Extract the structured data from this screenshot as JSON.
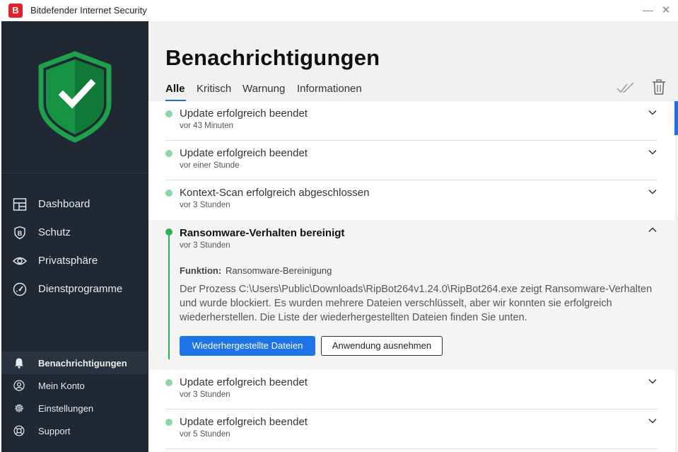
{
  "window": {
    "title": "Bitdefender Internet Security",
    "logo_letter": "B",
    "close_glyph": "✕"
  },
  "colors": {
    "sidebar_bg": "#1f2833",
    "accent_blue": "#1e73e6",
    "success_green": "#2db35d",
    "dot_light_green": "#8fd6a6",
    "brand_red": "#e5202a"
  },
  "sidebar": {
    "status_icon": "shield-check-icon",
    "nav": [
      {
        "label": "Dashboard",
        "icon": "dashboard-icon"
      },
      {
        "label": "Schutz",
        "icon": "protection-shield-icon"
      },
      {
        "label": "Privatsphäre",
        "icon": "eye-icon"
      },
      {
        "label": "Dienstprogramme",
        "icon": "gauge-icon"
      }
    ],
    "bottom": [
      {
        "label": "Benachrichtigungen",
        "icon": "bell-icon",
        "active": true
      },
      {
        "label": "Mein Konto",
        "icon": "user-icon"
      },
      {
        "label": "Einstellungen",
        "icon": "gear-icon"
      },
      {
        "label": "Support",
        "icon": "lifebuoy-icon"
      }
    ]
  },
  "main": {
    "title": "Benachrichtigungen",
    "tabs": [
      {
        "label": "Alle",
        "active": true
      },
      {
        "label": "Kritisch"
      },
      {
        "label": "Warnung"
      },
      {
        "label": "Informationen"
      }
    ],
    "toolbar_icons": [
      "mark-all-read-icon",
      "trash-icon"
    ],
    "notifications": [
      {
        "title": "Update erfolgreich beendet",
        "time": "vor 43 Minuten"
      },
      {
        "title": "Update erfolgreich beendet",
        "time": "vor einer Stunde"
      },
      {
        "title": "Kontext-Scan erfolgreich abgeschlossen",
        "time": "vor 3 Stunden"
      },
      {
        "title": "Update erfolgreich beendet",
        "time": "vor 3 Stunden"
      },
      {
        "title": "Update erfolgreich beendet",
        "time": "vor 5 Stunden"
      }
    ],
    "expanded": {
      "title": "Ransomware-Verhalten bereinigt",
      "time": "vor 3 Stunden",
      "function_label": "Funktion:",
      "function_value": "Ransomware-Bereinigung",
      "description": "Der Prozess C:\\Users\\Public\\Downloads\\RipBot264v1.24.0\\RipBot264.exe zeigt Ransomware-Verhalten und wurde blockiert. Es wurden mehrere Dateien verschlüsselt, aber wir konnten sie erfolgreich wiederherstellen. Die Liste der wiederhergestellten Dateien finden Sie unten.",
      "primary_button": "Wiederhergestellte Dateien",
      "secondary_button": "Anwendung ausnehmen"
    }
  }
}
